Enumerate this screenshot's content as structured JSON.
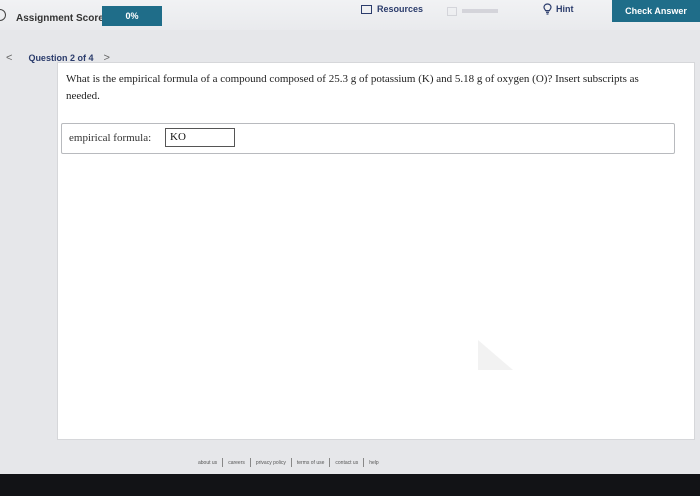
{
  "header": {
    "score_label": "Assignment Score:",
    "score_value": "0%",
    "resources_label": "Resources",
    "hint_label": "Hint",
    "check_answer_label": "Check Answer"
  },
  "navigation": {
    "prev": "<",
    "question_label": "Question 2 of 4",
    "next": ">"
  },
  "question": {
    "text": "What is the empirical formula of a compound composed of 25.3 g of potassium (K) and 5.18 g of oxygen (O)? Insert subscripts as needed."
  },
  "answer": {
    "label": "empirical formula:",
    "value": "KO"
  },
  "footer": {
    "links": [
      "about us",
      "careers",
      "privacy policy",
      "terms of use",
      "contact us",
      "help"
    ]
  }
}
